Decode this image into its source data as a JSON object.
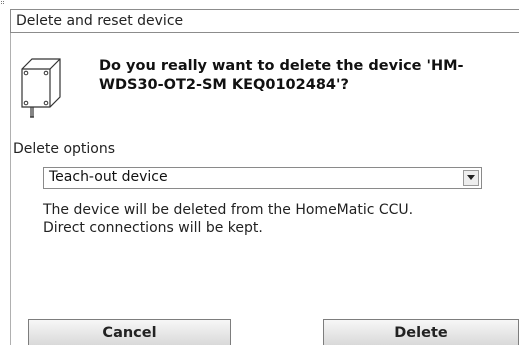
{
  "dialog": {
    "title": "Delete and reset device",
    "question_line1": "Do you really want to delete the device 'HM-",
    "question_line2": "WDS30-OT2-SM KEQ0102484'?",
    "device_icon": "device-box-icon",
    "options_label": "Delete options",
    "selected_option": "Teach-out device",
    "info_line1": "The device will be deleted from the HomeMatic CCU.",
    "info_line2": "Direct connections will be kept.",
    "cancel_label": "Cancel",
    "delete_label": "Delete"
  }
}
